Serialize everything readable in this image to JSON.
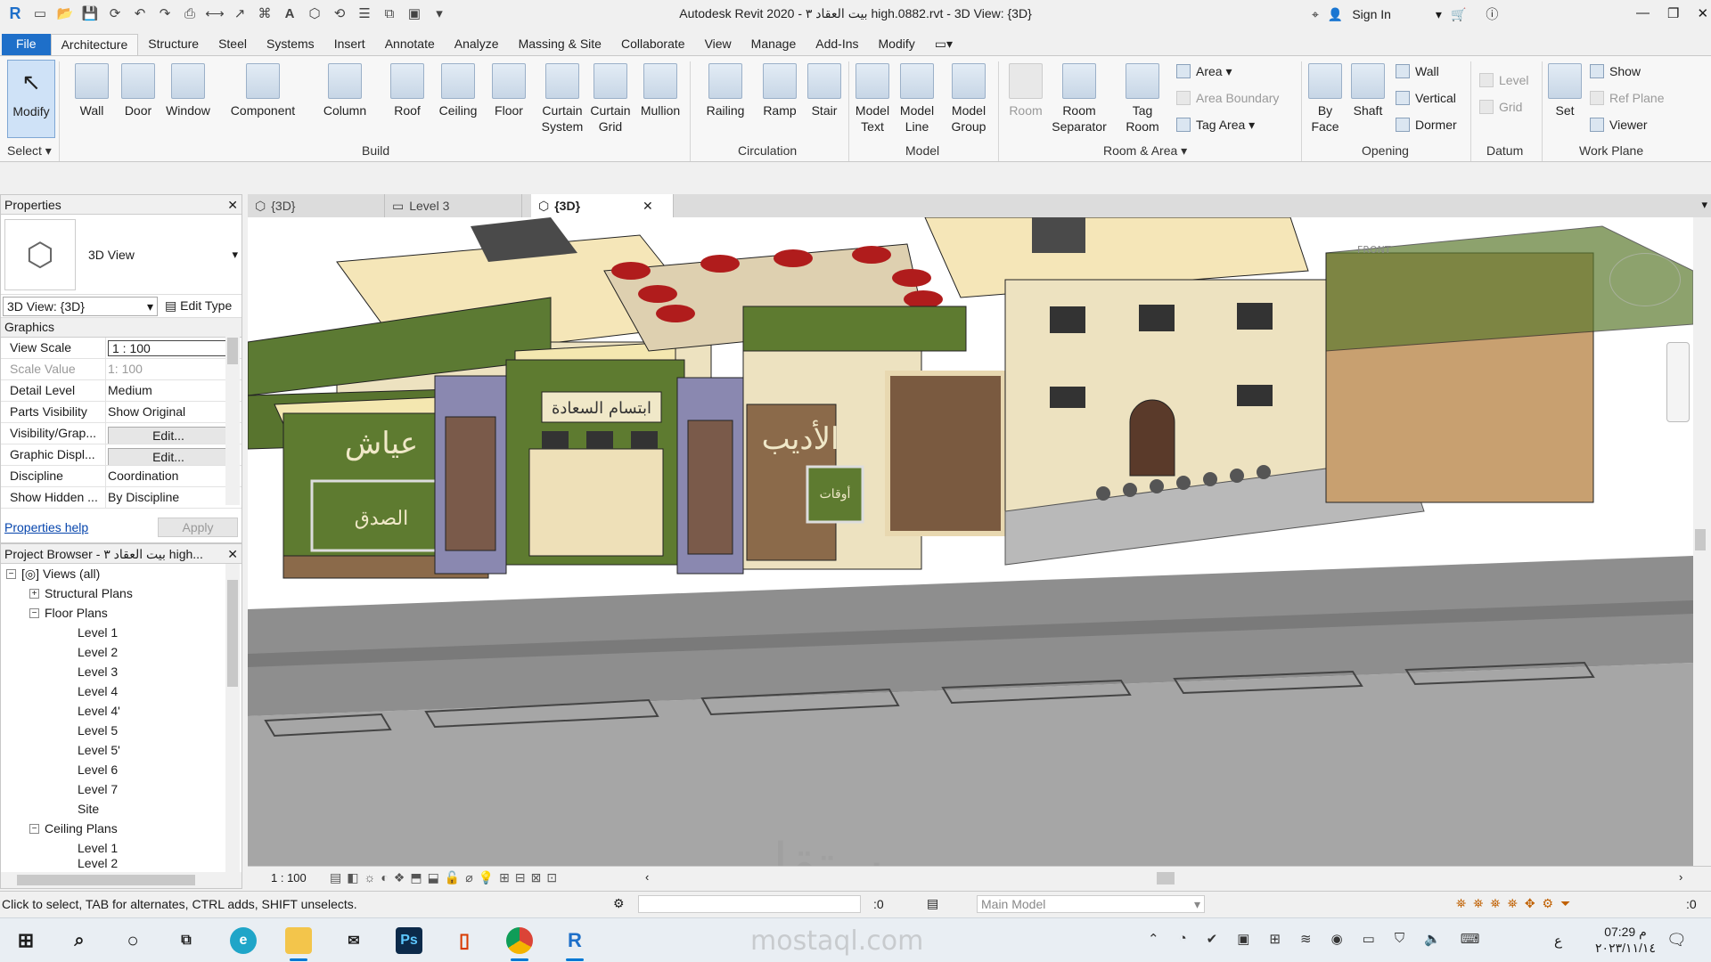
{
  "title": "Autodesk Revit 2020 - بيت العقاد ٣ high.0882.rvt - 3D View: {3D}",
  "signin": "Sign In",
  "menu": [
    "File",
    "Architecture",
    "Structure",
    "Steel",
    "Systems",
    "Insert",
    "Annotate",
    "Analyze",
    "Massing & Site",
    "Collaborate",
    "View",
    "Manage",
    "Add-Ins",
    "Modify"
  ],
  "ribbon": {
    "modify": "Modify",
    "select": "Select",
    "build": {
      "label": "Build",
      "items": [
        "Wall",
        "Door",
        "Window",
        "Component",
        "Column",
        "Roof",
        "Ceiling",
        "Floor",
        "Curtain System",
        "Curtain Grid",
        "Mullion"
      ]
    },
    "circulation": {
      "label": "Circulation",
      "items": [
        "Railing",
        "Ramp",
        "Stair"
      ]
    },
    "model": {
      "label": "Model",
      "items": [
        "Model Text",
        "Model Line",
        "Model Group"
      ]
    },
    "room_area": {
      "label": "Room & Area",
      "room": "Room",
      "room_separator": "Room Separator",
      "tag_room": "Tag Room",
      "area": "Area",
      "area_boundary": "Area Boundary",
      "tag_area": "Tag Area"
    },
    "opening": {
      "label": "Opening",
      "by_face": "By Face",
      "shaft": "Shaft",
      "wall": "Wall",
      "vertical": "Vertical",
      "dormer": "Dormer"
    },
    "datum": {
      "label": "Datum",
      "level": "Level",
      "grid": "Grid"
    },
    "work_plane": {
      "label": "Work Plane",
      "set": "Set",
      "show": "Show",
      "ref_plane": "Ref Plane",
      "viewer": "Viewer"
    }
  },
  "properties": {
    "header": "Properties",
    "type": "3D View",
    "selector": "3D View: {3D}",
    "edit_type": "Edit Type",
    "group": "Graphics",
    "rows": [
      {
        "k": "View Scale",
        "v": "1 : 100"
      },
      {
        "k": "Scale Value",
        "v": "1:  100"
      },
      {
        "k": "Detail Level",
        "v": "Medium"
      },
      {
        "k": "Parts Visibility",
        "v": "Show Original"
      },
      {
        "k": "Visibility/Grap...",
        "v": "Edit..."
      },
      {
        "k": "Graphic Displ...",
        "v": "Edit..."
      },
      {
        "k": "Discipline",
        "v": "Coordination"
      },
      {
        "k": "Show Hidden ...",
        "v": "By Discipline"
      }
    ],
    "help": "Properties help",
    "apply": "Apply"
  },
  "browser": {
    "header": "Project Browser - بيت العقاد ٣ high...",
    "views_all": "Views (all)",
    "structural_plans": "Structural Plans",
    "floor_plans": "Floor Plans",
    "levels": [
      "Level 1",
      "Level 2",
      "Level 3",
      "Level 4",
      "Level 4'",
      "Level 5",
      "Level 5'",
      "Level 6",
      "Level 7",
      "Site"
    ],
    "ceiling_plans": "Ceiling Plans",
    "ceiling_levels": [
      "Level 1",
      "Level 2"
    ]
  },
  "tabs": [
    "{3D}",
    "Level 3",
    "{3D}"
  ],
  "viewcube": "FRONT",
  "view_scale": "1 : 100",
  "status": {
    "hint": "Click to select, TAB for alternates, CTRL adds, SHIFT unselects.",
    "count": ":0",
    "model": "Main Model",
    "filter": ":0"
  },
  "clock": {
    "time": "07:29 م",
    "date": "٢٠٢٣/١١/١٤",
    "lang": "ع"
  },
  "watermark": {
    "arabic": "مستقل",
    "latin": "mostaql.com"
  },
  "signage": {
    "sign1": "عياش",
    "sign2": "الصدق",
    "sign3": "ابتسام السعادة",
    "sign4": "الأديب",
    "sign5": "أوقات"
  }
}
